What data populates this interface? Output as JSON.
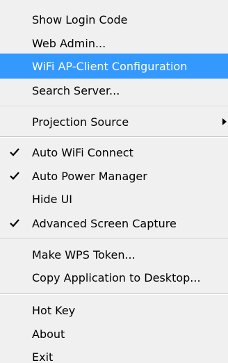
{
  "menu": {
    "items": [
      {
        "label": "Show Login Code",
        "checked": false,
        "submenu": false,
        "selected": false
      },
      {
        "label": "Web Admin...",
        "checked": false,
        "submenu": false,
        "selected": false
      },
      {
        "label": "WiFi AP-Client Configuration",
        "checked": false,
        "submenu": false,
        "selected": true
      },
      {
        "label": "Search Server...",
        "checked": false,
        "submenu": false,
        "selected": false
      },
      {
        "label": "Projection Source",
        "checked": false,
        "submenu": true,
        "selected": false
      },
      {
        "label": "Auto WiFi Connect",
        "checked": true,
        "submenu": false,
        "selected": false
      },
      {
        "label": "Auto Power Manager",
        "checked": true,
        "submenu": false,
        "selected": false
      },
      {
        "label": "Hide UI",
        "checked": false,
        "submenu": false,
        "selected": false
      },
      {
        "label": "Advanced Screen Capture",
        "checked": true,
        "submenu": false,
        "selected": false
      },
      {
        "label": "Make WPS Token...",
        "checked": false,
        "submenu": false,
        "selected": false
      },
      {
        "label": "Copy Application to Desktop...",
        "checked": false,
        "submenu": false,
        "selected": false
      },
      {
        "label": "Hot Key",
        "checked": false,
        "submenu": false,
        "selected": false
      },
      {
        "label": "About",
        "checked": false,
        "submenu": false,
        "selected": false
      },
      {
        "label": "Exit",
        "checked": false,
        "submenu": false,
        "selected": false
      }
    ]
  },
  "colors": {
    "background": "#f0f0f0",
    "highlight": "#3399ff",
    "highlight_text": "#ffffff",
    "text": "#000000",
    "separator": "#c8c8c8"
  }
}
